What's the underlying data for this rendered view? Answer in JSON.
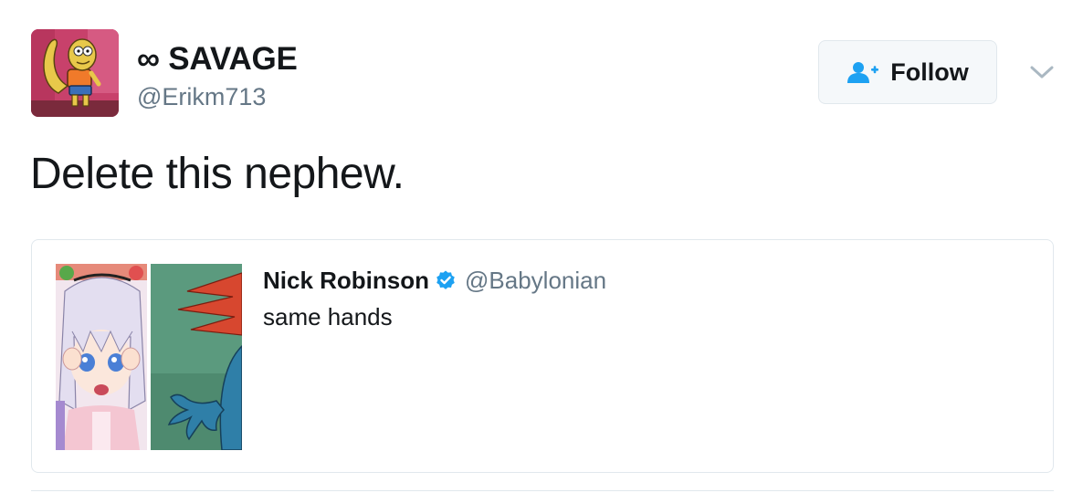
{
  "author": {
    "display_name": "∞ SAVAGE",
    "handle": "@Erikm713",
    "avatar_icon": "cartoon-lizard-avatar"
  },
  "follow_button": {
    "label": "Follow",
    "icon": "add-user-icon"
  },
  "menu": {
    "icon": "chevron-down-icon"
  },
  "tweet": {
    "text": "Delete this nephew."
  },
  "quoted_tweet": {
    "author_name": "Nick Robinson",
    "verified": true,
    "handle": "@Babylonian",
    "text": "same hands",
    "media_icons": [
      "anime-girl-thumbnail",
      "cartoon-hand-thumbnail"
    ]
  },
  "colors": {
    "text_primary": "#14171a",
    "text_secondary": "#657786",
    "accent": "#1da1f2",
    "border": "#e1e8ed",
    "button_bg": "#f5f8fa"
  }
}
